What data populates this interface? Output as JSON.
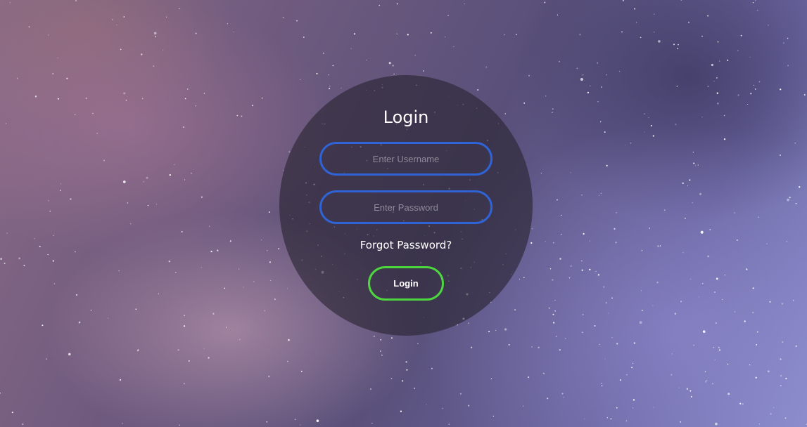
{
  "login": {
    "title": "Login",
    "username_placeholder": "Enter Username",
    "password_placeholder": "Enter Password",
    "forgot_label": "Forgot Password?",
    "button_label": "Login"
  },
  "colors": {
    "input_border": "#2f63d6",
    "button_border": "#4ed63f",
    "text": "#ffffff"
  },
  "icons": {
    "background": "starry-night-sky-image"
  }
}
